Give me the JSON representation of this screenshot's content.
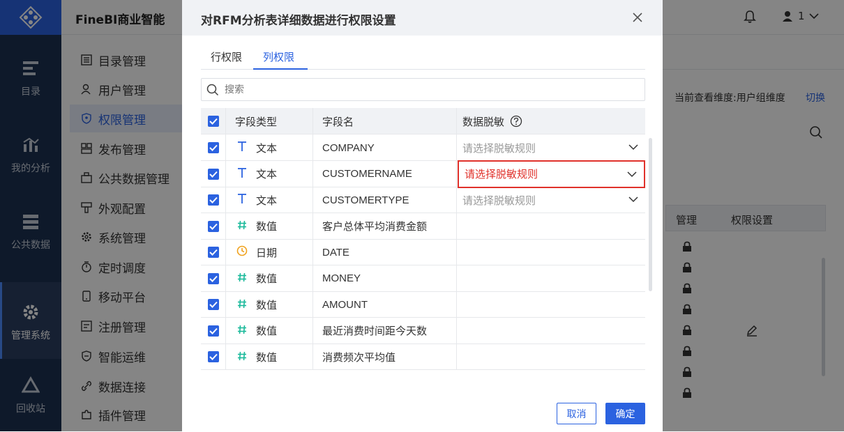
{
  "app": {
    "title": "FineBI商业智能",
    "user_name": "1"
  },
  "sidebar": {
    "items": [
      {
        "label": "目录",
        "icon": "catalog-icon"
      },
      {
        "label": "我的分析",
        "icon": "analysis-icon"
      },
      {
        "label": "公共数据",
        "icon": "public-data-icon"
      },
      {
        "label": "管理系统",
        "icon": "gear-icon",
        "active": true
      },
      {
        "label": "回收站",
        "icon": "recycle-icon"
      }
    ]
  },
  "menu": {
    "items": [
      {
        "label": "目录管理",
        "icon": "catalog-manage-icon"
      },
      {
        "label": "用户管理",
        "icon": "user-manage-icon"
      },
      {
        "label": "权限管理",
        "icon": "permission-icon",
        "active": true
      },
      {
        "label": "发布管理",
        "icon": "publish-icon"
      },
      {
        "label": "公共数据管理",
        "icon": "public-data-manage-icon"
      },
      {
        "label": "外观配置",
        "icon": "appearance-icon"
      },
      {
        "label": "系统管理",
        "icon": "system-icon"
      },
      {
        "label": "定时调度",
        "icon": "schedule-icon"
      },
      {
        "label": "移动平台",
        "icon": "mobile-icon"
      },
      {
        "label": "注册管理",
        "icon": "register-icon"
      },
      {
        "label": "智能运维",
        "icon": "ops-icon"
      },
      {
        "label": "数据连接",
        "icon": "connection-icon"
      },
      {
        "label": "插件管理",
        "icon": "plugin-icon"
      }
    ]
  },
  "background": {
    "dimension_text": "当前查看维度:用户组维度",
    "switch_label": "切换",
    "table_headers": [
      "管理",
      "权限设置"
    ]
  },
  "dialog": {
    "title": "对RFM分析表详细数据进行权限设置",
    "tabs": [
      {
        "label": "行权限",
        "active": false
      },
      {
        "label": "列权限",
        "active": true
      }
    ],
    "search_placeholder": "搜索",
    "columns": [
      "字段类型",
      "字段名",
      "数据脱敏"
    ],
    "rows": [
      {
        "type": "文本",
        "icon": "text-type-icon",
        "field": "COMPANY",
        "mask": "请选择脱敏规则",
        "has_select": true,
        "highlight": false
      },
      {
        "type": "文本",
        "icon": "text-type-icon",
        "field": "CUSTOMERNAME",
        "mask": "请选择脱敏规则",
        "has_select": true,
        "highlight": true
      },
      {
        "type": "文本",
        "icon": "text-type-icon",
        "field": "CUSTOMERTYPE",
        "mask": "请选择脱敏规则",
        "has_select": true,
        "highlight": false
      },
      {
        "type": "数值",
        "icon": "number-type-icon",
        "field": "客户总体平均消费金额",
        "mask": "",
        "has_select": false,
        "highlight": false
      },
      {
        "type": "日期",
        "icon": "date-type-icon",
        "field": "DATE",
        "mask": "",
        "has_select": false,
        "highlight": false
      },
      {
        "type": "数值",
        "icon": "number-type-icon",
        "field": "MONEY",
        "mask": "",
        "has_select": false,
        "highlight": false
      },
      {
        "type": "数值",
        "icon": "number-type-icon",
        "field": "AMOUNT",
        "mask": "",
        "has_select": false,
        "highlight": false
      },
      {
        "type": "数值",
        "icon": "number-type-icon",
        "field": "最近消费时间距今天数",
        "mask": "",
        "has_select": false,
        "highlight": false
      },
      {
        "type": "数值",
        "icon": "number-type-icon",
        "field": "消费频次平均值",
        "mask": "",
        "has_select": false,
        "highlight": false
      }
    ],
    "cancel_label": "取消",
    "ok_label": "确定"
  },
  "colors": {
    "brand": "#2b62e0",
    "sidebar_bg": "#1c3151",
    "highlight_red": "#e0312b",
    "number_icon": "#19b99a",
    "date_icon": "#f0a21e"
  }
}
